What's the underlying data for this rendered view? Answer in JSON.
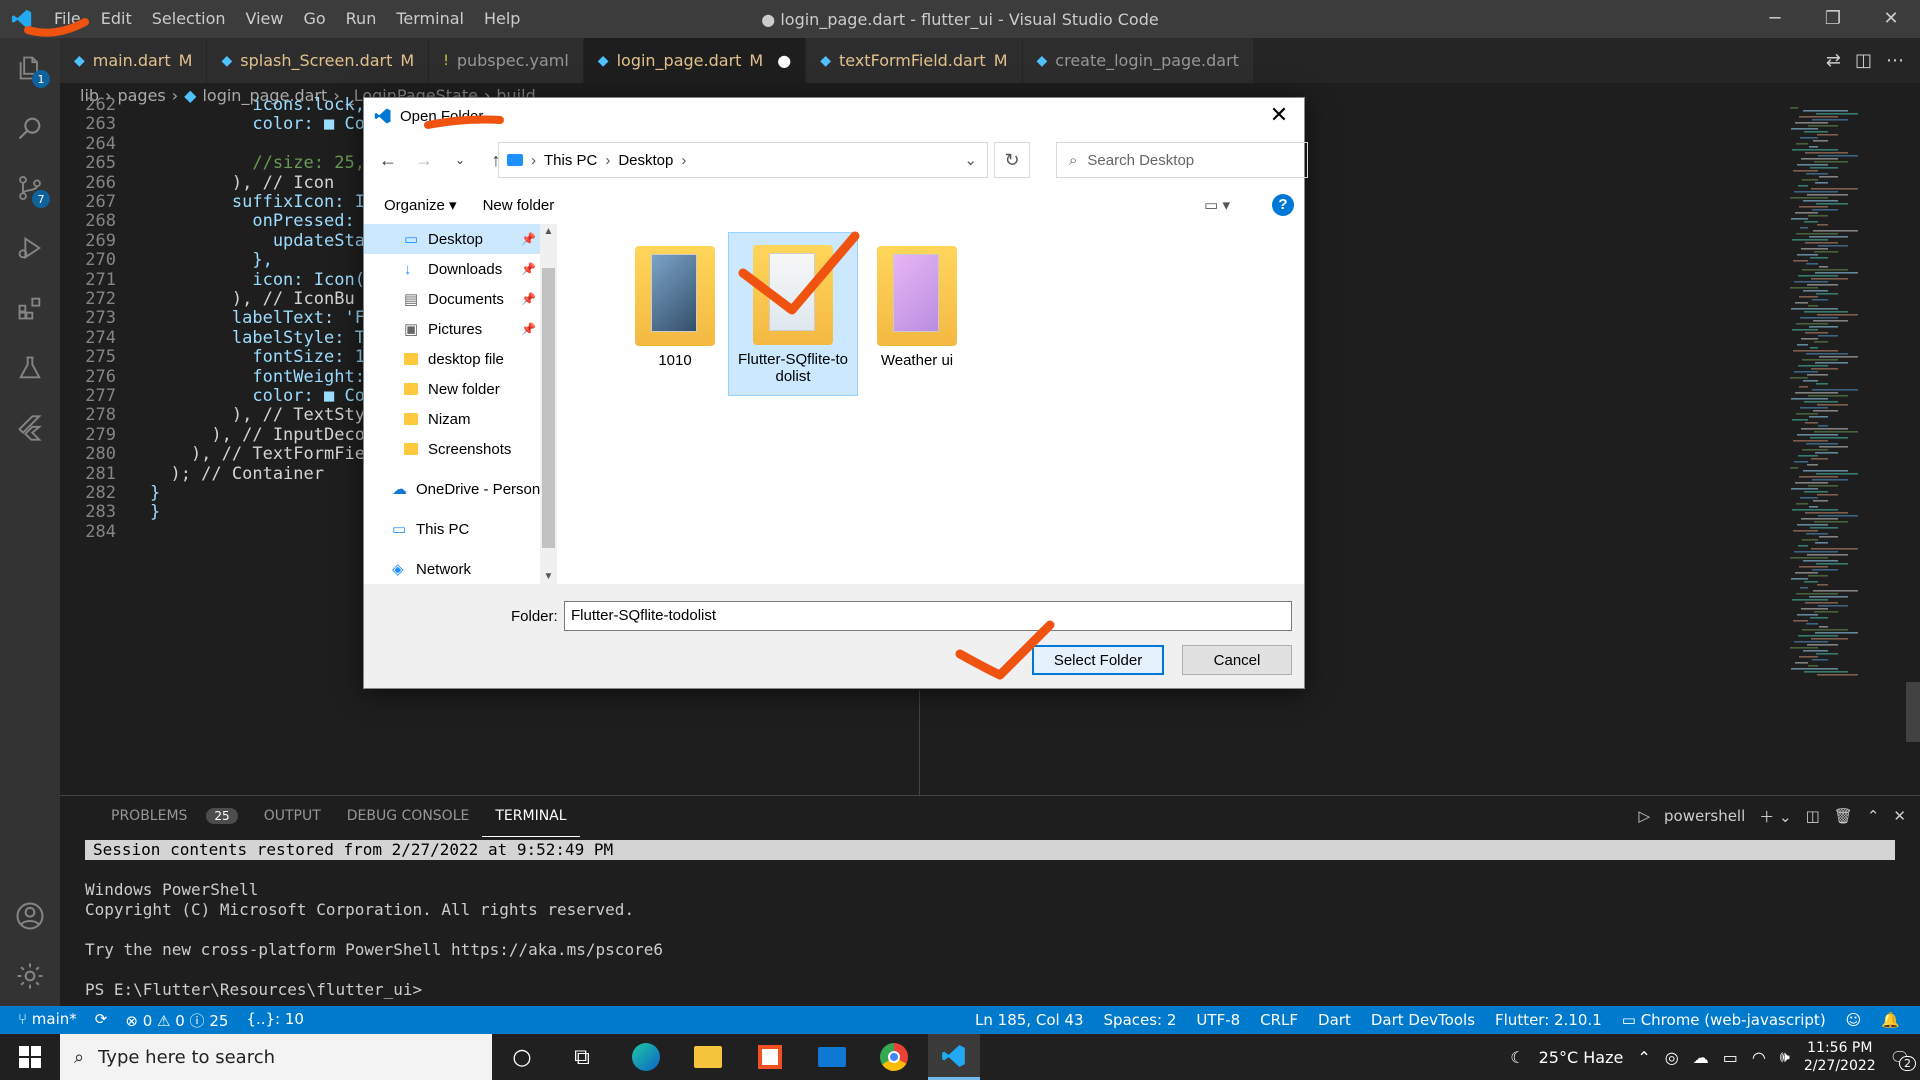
{
  "titlebar": {
    "menus": [
      "File",
      "Edit",
      "Selection",
      "View",
      "Go",
      "Run",
      "Terminal",
      "Help"
    ],
    "title": "● login_page.dart - flutter_ui - Visual Studio Code"
  },
  "activity": {
    "explorer_badge": "1",
    "scm_badge": "7"
  },
  "tabs": [
    {
      "label": "main.dart",
      "mod": "M",
      "icon": "dart-icon"
    },
    {
      "label": "splash_Screen.dart",
      "mod": "M",
      "icon": "dart-icon"
    },
    {
      "label": "pubspec.yaml",
      "mod": "",
      "icon": "yaml-icon"
    },
    {
      "label": "login_page.dart",
      "mod": "M",
      "icon": "dart-icon",
      "active": true,
      "dirty": "●"
    },
    {
      "label": "textFormField.dart",
      "mod": "M",
      "icon": "dart-icon"
    },
    {
      "label": "create_login_page.dart",
      "mod": "",
      "icon": "dart-icon"
    }
  ],
  "breadcrumb": [
    "lib",
    "pages",
    "login_page.dart",
    "_LoginPageState",
    "build"
  ],
  "editor": {
    "lines": [
      {
        "n": "262",
        "code": "          icons.lock,"
      },
      {
        "n": "263",
        "code": "          color: ■ Co"
      },
      {
        "n": "264",
        "code": ""
      },
      {
        "n": "265",
        "code": "          //size: 25,"
      },
      {
        "n": "266",
        "code": "        ), // Icon"
      },
      {
        "n": "267",
        "code": "        suffixIcon: I"
      },
      {
        "n": "268",
        "code": "          onPressed:"
      },
      {
        "n": "269",
        "code": "            updateSta"
      },
      {
        "n": "270",
        "code": "          },"
      },
      {
        "n": "271",
        "code": "          icon: Icon("
      },
      {
        "n": "272",
        "code": "        ), // IconBu"
      },
      {
        "n": "273",
        "code": "        labelText: 'F"
      },
      {
        "n": "274",
        "code": "        labelStyle: T"
      },
      {
        "n": "275",
        "code": "          fontSize: 1"
      },
      {
        "n": "276",
        "code": "          fontWeight:"
      },
      {
        "n": "277",
        "code": "          color: ■ Co"
      },
      {
        "n": "278",
        "code": "        ), // TextSty"
      },
      {
        "n": "279",
        "code": "      ), // InputDeco"
      },
      {
        "n": "280",
        "code": "    ), // TextFormFie"
      },
      {
        "n": "281",
        "code": "  ); // Container"
      },
      {
        "n": "282",
        "code": "}"
      },
      {
        "n": "283",
        "code": "}"
      },
      {
        "n": "284",
        "code": ""
      }
    ]
  },
  "dialog": {
    "title": "Open Folder",
    "path": [
      "This PC",
      "Desktop"
    ],
    "search_placeholder": "Search Desktop",
    "organize": "Organize ▾",
    "new_folder": "New folder",
    "nav_items": [
      {
        "label": "Desktop",
        "icon": "desktop-icon",
        "pinned": true,
        "selected": true
      },
      {
        "label": "Downloads",
        "icon": "downloads-icon",
        "pinned": true
      },
      {
        "label": "Documents",
        "icon": "documents-icon",
        "pinned": true
      },
      {
        "label": "Pictures",
        "icon": "pictures-icon",
        "pinned": true
      },
      {
        "label": "desktop file",
        "icon": "folder-icon"
      },
      {
        "label": "New folder",
        "icon": "folder-icon"
      },
      {
        "label": "Nizam",
        "icon": "folder-icon"
      },
      {
        "label": "Screenshots",
        "icon": "folder-icon"
      },
      {
        "label": "OneDrive - Person",
        "icon": "onedrive-icon",
        "root": true
      },
      {
        "label": "This PC",
        "icon": "this-pc-icon",
        "root": true
      },
      {
        "label": "Network",
        "icon": "network-icon",
        "root": true
      }
    ],
    "files": [
      {
        "label": "1010"
      },
      {
        "label": "Flutter-SQflite-to\ndolist",
        "selected": true
      },
      {
        "label": "Weather ui"
      }
    ],
    "folder_label": "Folder:",
    "folder_value": "Flutter-SQflite-todolist",
    "select_button": "Select Folder",
    "cancel_button": "Cancel"
  },
  "panel": {
    "tabs": [
      "PROBLEMS",
      "OUTPUT",
      "DEBUG CONSOLE",
      "TERMINAL"
    ],
    "problems_count": "25",
    "shell": "powershell",
    "terminal_highlight": "Session contents restored from 2/27/2022 at 9:52:49 PM",
    "terminal_lines": [
      "",
      "Windows PowerShell",
      "Copyright (C) Microsoft Corporation. All rights reserved.",
      "",
      "Try the new cross-platform PowerShell https://aka.ms/pscore6",
      "",
      "PS E:\\Flutter\\Resources\\flutter_ui>"
    ]
  },
  "status": {
    "branch": "main*",
    "errors": "0",
    "warnings": "0",
    "infos": "25",
    "braces": "{..}: 10",
    "position": "Ln 185, Col 43",
    "spaces": "Spaces: 2",
    "encoding": "UTF-8",
    "eol": "CRLF",
    "language": "Dart",
    "devtools": "Dart DevTools",
    "flutter": "Flutter: 2.10.1",
    "device": "Chrome (web-javascript)"
  },
  "taskbar": {
    "search_placeholder": "Type here to search",
    "weather": "25°C  Haze",
    "time": "11:56 PM",
    "date": "2/27/2022",
    "notif": "2"
  }
}
